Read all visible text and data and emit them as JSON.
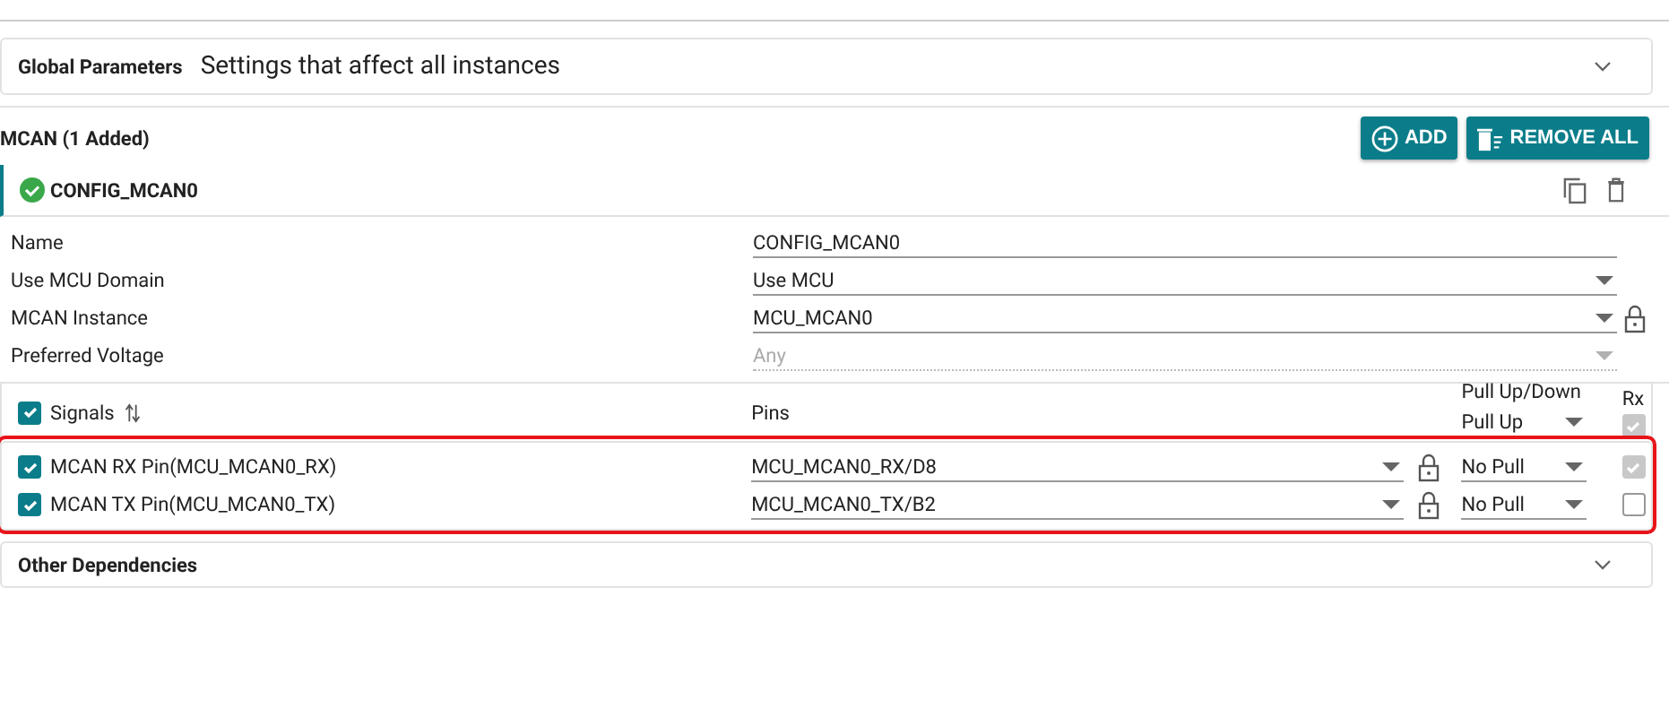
{
  "global_parameters": {
    "title": "Global Parameters",
    "description": "Settings that affect all instances",
    "expanded": false
  },
  "module": {
    "title": "MCAN (1 Added)",
    "buttons": [
      {
        "kind": "add",
        "label": "ADD"
      },
      {
        "kind": "remove",
        "label": "REMOVE ALL"
      }
    ]
  },
  "instance": {
    "name": "CONFIG_MCAN0",
    "valid": true
  },
  "fields": [
    {
      "label": "Name",
      "kind": "text",
      "value": "CONFIG_MCAN0",
      "disabled": false,
      "locked": false
    },
    {
      "label": "Use MCU Domain",
      "kind": "select",
      "value": "Use MCU",
      "disabled": false,
      "locked": false
    },
    {
      "label": "MCAN Instance",
      "kind": "select",
      "value": "MCU_MCAN0",
      "disabled": false,
      "locked": true
    },
    {
      "label": "Preferred Voltage",
      "kind": "select",
      "value": "Any",
      "disabled": true,
      "locked": false
    }
  ],
  "signals": {
    "header": {
      "label": "Signals",
      "checked": true,
      "pins_label": "Pins",
      "pull_label": "Pull Up/Down",
      "pull_value": "Pull Up",
      "rx_label": "Rx",
      "rx_checked": true
    },
    "rows": [
      {
        "label": "MCAN RX Pin(MCU_MCAN0_RX)",
        "checked": true,
        "pin": "MCU_MCAN0_RX/D8",
        "locked": true,
        "pull": "No Pull",
        "rx_checked": true,
        "rx_disabled": true
      },
      {
        "label": "MCAN TX Pin(MCU_MCAN0_TX)",
        "checked": true,
        "pin": "MCU_MCAN0_TX/B2",
        "locked": true,
        "pull": "No Pull",
        "rx_checked": false,
        "rx_disabled": false
      }
    ],
    "highlighted": true
  },
  "other_dependencies": {
    "title": "Other Dependencies",
    "expanded": false
  }
}
